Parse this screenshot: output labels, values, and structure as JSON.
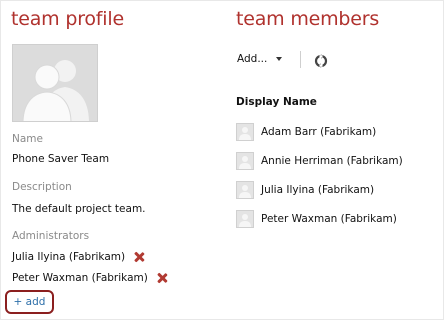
{
  "profile": {
    "title": "team profile",
    "name_label": "Name",
    "name_value": "Phone Saver Team",
    "description_label": "Description",
    "description_value": "The default project team.",
    "administrators_label": "Administrators",
    "administrators": [
      {
        "name": "Julia Ilyina (Fabrikam)"
      },
      {
        "name": "Peter Waxman (Fabrikam)"
      }
    ],
    "add_link": "+ add"
  },
  "members": {
    "title": "team members",
    "add_menu_label": "Add...",
    "column_header": "Display Name",
    "list": [
      {
        "name": "Adam Barr (Fabrikam)"
      },
      {
        "name": "Annie Herriman (Fabrikam)"
      },
      {
        "name": "Julia Ilyina (Fabrikam)"
      },
      {
        "name": "Peter Waxman (Fabrikam)"
      }
    ]
  },
  "icons": {
    "avatar": "team-avatar-icon",
    "remove": "remove-x-icon",
    "refresh": "refresh-icon",
    "dropdown": "chevron-down-icon"
  },
  "colors": {
    "heading": "#b0322e",
    "remove_icon": "#b13a32",
    "link": "#2d6fa9",
    "highlight_border": "#8b1f1f"
  }
}
